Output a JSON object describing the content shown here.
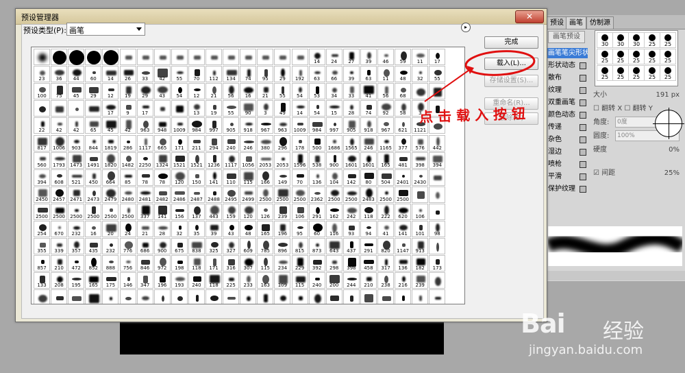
{
  "background_panel": {
    "tabs": [
      "预设",
      "画笔",
      "仿制源"
    ],
    "preset_button": "画笔预设",
    "options": [
      {
        "label": "画笔笔尖形状",
        "locked": false,
        "selected": true
      },
      {
        "label": "形状动态",
        "locked": true,
        "selected": false
      },
      {
        "label": "散布",
        "locked": true,
        "selected": false
      },
      {
        "label": "纹理",
        "locked": true,
        "selected": false
      },
      {
        "label": "双重画笔",
        "locked": true,
        "selected": false
      },
      {
        "label": "颜色动态",
        "locked": true,
        "selected": false
      },
      {
        "label": "传递",
        "locked": true,
        "selected": false
      },
      {
        "label": "杂色",
        "locked": true,
        "selected": false
      },
      {
        "label": "湿边",
        "locked": true,
        "selected": false
      },
      {
        "label": "喷枪",
        "locked": true,
        "selected": false
      },
      {
        "label": "平滑",
        "locked": true,
        "selected": false
      },
      {
        "label": "保护纹理",
        "locked": true,
        "selected": false
      }
    ],
    "thumb_sizes": [
      "30",
      "30",
      "30",
      "25",
      "25",
      "25",
      "25",
      "25",
      "25",
      "25",
      "25",
      "25",
      "25",
      "25",
      "25"
    ],
    "controls": {
      "size_label": "大小",
      "size_value": "191 px",
      "flip_x": "翻转 X",
      "flip_y": "翻转 Y",
      "angle_label": "角度:",
      "angle_value": "0度",
      "roundness_label": "圆度:",
      "roundness_value": "100%",
      "hardness_label": "硬度",
      "hardness_value": "0%",
      "spacing_label": "间距",
      "spacing_value": "25%"
    }
  },
  "dialog": {
    "title": "预设管理器",
    "close_glyph": "✕",
    "preset_type_label": "预设类型(P):",
    "preset_type_value": "画笔",
    "menu_glyph": "▸",
    "buttons": {
      "done": "完成",
      "load": "载入(L)...",
      "save": "存储设置(S)...",
      "rename": "重命名(R)...",
      "delete": "删除(D)"
    }
  },
  "brush_grid": {
    "rows": [
      [
        "",
        "",
        "",
        "",
        "",
        "",
        "",
        "",
        "",
        "",
        "",
        "",
        "",
        "",
        "",
        "",
        "14",
        "24",
        "27",
        "39",
        "46",
        "59",
        "11",
        "17"
      ],
      [
        "23",
        "36",
        "44",
        "60",
        "14",
        "26",
        "33",
        "42",
        "55",
        "70",
        "112",
        "134",
        "74",
        "95",
        "29",
        "192",
        "63",
        "66",
        "39",
        "63",
        "11",
        "48",
        "32",
        "55"
      ],
      [
        "100",
        "75",
        "45",
        "29",
        "12",
        "19",
        "29",
        "43",
        "54",
        "12",
        "21",
        "56",
        "16",
        "21",
        "55",
        "54",
        "53",
        "34",
        "33",
        "41",
        "56",
        "68",
        "",
        ""
      ],
      [
        "",
        "",
        "",
        "",
        "17",
        "9",
        "17",
        "",
        "",
        "13",
        "19",
        "55",
        "90",
        "3",
        "49",
        "14",
        "54",
        "15",
        "28",
        "74",
        "92",
        "58",
        "3",
        ""
      ],
      [
        "22",
        "42",
        "42",
        "65",
        "45",
        "42",
        "963",
        "948",
        "1009",
        "984",
        "997",
        "905",
        "918",
        "967",
        "963",
        "1009",
        "984",
        "997",
        "905",
        "918",
        "967",
        "621",
        "1121",
        ""
      ],
      [
        "817",
        "1006",
        "903",
        "844",
        "1819",
        "286",
        "1117",
        "665",
        "171",
        "211",
        "294",
        "240",
        "246",
        "380",
        "296",
        "178",
        "500",
        "1686",
        "1565",
        "246",
        "1165",
        "377",
        "576",
        "442"
      ],
      [
        "560",
        "1793",
        "1473",
        "1491",
        "1820",
        "1482",
        "2250",
        "1324",
        "1521",
        "1521",
        "1236",
        "1117",
        "1056",
        "2053",
        "2053",
        "1596",
        "538",
        "900",
        "1601",
        "1601",
        "165",
        "481",
        "398",
        "394"
      ],
      [
        "394",
        "608",
        "521",
        "450",
        "664",
        "85",
        "78",
        "78",
        "120",
        "150",
        "141",
        "110",
        "115",
        "166",
        "149",
        "70",
        "136",
        "104",
        "142",
        "80",
        "504",
        "2401",
        "2430",
        ""
      ],
      [
        "2450",
        "2457",
        "2471",
        "2473",
        "2479",
        "2480",
        "2481",
        "2482",
        "2486",
        "2487",
        "2488",
        "2495",
        "2499",
        "2500",
        "2500",
        "2500",
        "2362",
        "2500",
        "2500",
        "2483",
        "2500",
        "2500",
        "",
        ""
      ],
      [
        "2500",
        "2500",
        "2500",
        "2500",
        "2500",
        "2500",
        "337",
        "141",
        "156",
        "137",
        "443",
        "159",
        "120",
        "126",
        "239",
        "106",
        "291",
        "162",
        "242",
        "118",
        "222",
        "620",
        "106",
        ""
      ],
      [
        "254",
        "670",
        "232",
        "16",
        "20",
        "24",
        "21",
        "28",
        "32",
        "35",
        "39",
        "43",
        "48",
        "165",
        "196",
        "95",
        "60",
        "116",
        "93",
        "94",
        "41",
        "141",
        "101",
        "98"
      ],
      [
        "355",
        "339",
        "357",
        "435",
        "232",
        "776",
        "686",
        "900",
        "675",
        "838",
        "325",
        "327",
        "609",
        "785",
        "896",
        "815",
        "873",
        "643",
        "437",
        "291",
        "820",
        "1147",
        "913",
        ""
      ],
      [
        "857",
        "210",
        "472",
        "852",
        "888",
        "756",
        "846",
        "972",
        "198",
        "118",
        "171",
        "316",
        "307",
        "115",
        "234",
        "229",
        "392",
        "298",
        "398",
        "458",
        "317",
        "136",
        "182",
        "173"
      ],
      [
        "133",
        "208",
        "195",
        "165",
        "175",
        "146",
        "347",
        "196",
        "193",
        "240",
        "118",
        "225",
        "233",
        "163",
        "109",
        "115",
        "240",
        "200",
        "244",
        "210",
        "238",
        "216",
        "239",
        ""
      ],
      [
        "",
        "",
        "",
        "",
        "",
        "",
        "",
        "",
        "",
        "",
        "",
        "",
        "",
        "",
        "",
        "",
        "",
        "",
        "",
        "",
        "",
        "",
        "",
        ""
      ]
    ]
  },
  "annotation": {
    "text": "点击载入按钮",
    "color": "#e01010"
  },
  "watermark": {
    "logo": "Bai",
    "logo_cn": "经验",
    "url": "jingyan.baidu.com"
  },
  "colors": {
    "selected_option": "#3a7bd6",
    "annotation_red": "#e01010",
    "dialog_bg": "#ebe8d6"
  }
}
